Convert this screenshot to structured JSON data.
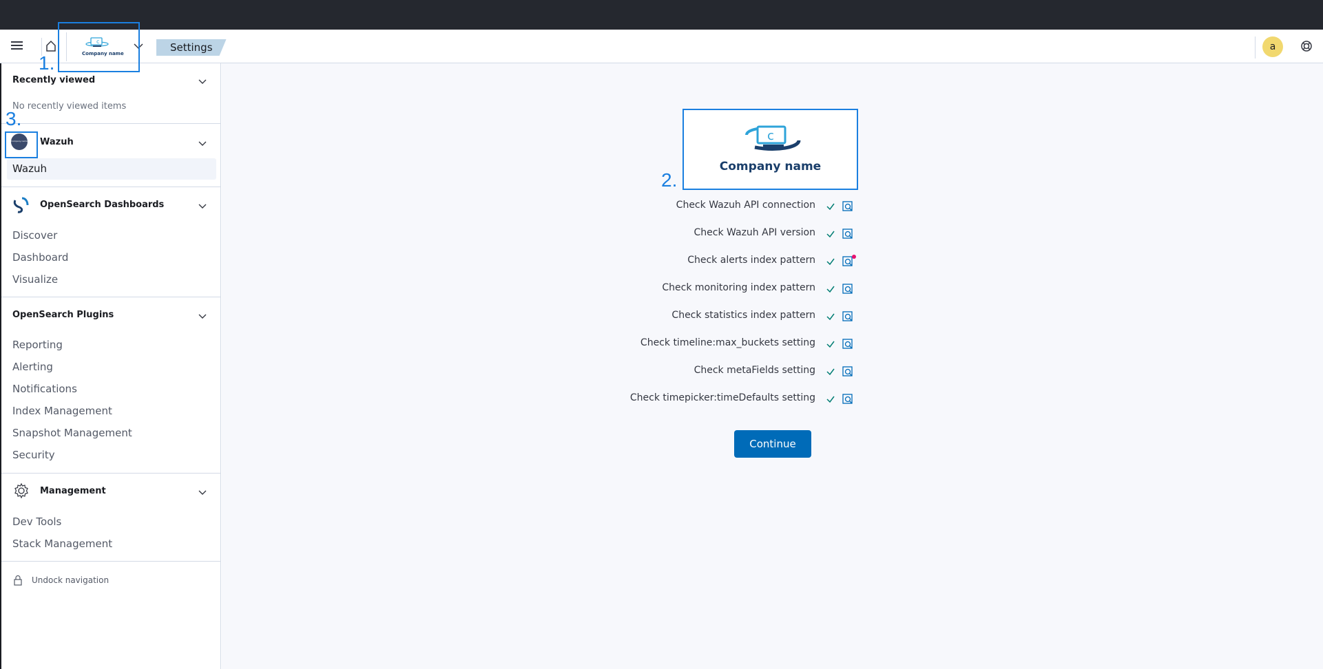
{
  "header": {
    "breadcrumb": "Settings",
    "avatar_initial": "a",
    "logo_text": "Company name"
  },
  "annotations": {
    "one": "1.",
    "two": "2.",
    "three": "3."
  },
  "sidebar": {
    "recently_viewed": {
      "title": "Recently viewed",
      "empty_text": "No recently viewed items"
    },
    "wazuh": {
      "title": "Wazuh",
      "item": "Wazuh",
      "icon_text": "Company name"
    },
    "opensearch_dashboards": {
      "title": "OpenSearch Dashboards",
      "items": [
        "Discover",
        "Dashboard",
        "Visualize"
      ]
    },
    "opensearch_plugins": {
      "title": "OpenSearch Plugins",
      "items": [
        "Reporting",
        "Alerting",
        "Notifications",
        "Index Management",
        "Snapshot Management",
        "Security"
      ]
    },
    "management": {
      "title": "Management",
      "items": [
        "Dev Tools",
        "Stack Management"
      ]
    },
    "undock_label": "Undock navigation"
  },
  "main": {
    "brand_name": "Company name",
    "checks": [
      {
        "label": "Check Wazuh API connection",
        "status": "ok"
      },
      {
        "label": "Check Wazuh API version",
        "status": "ok"
      },
      {
        "label": "Check alerts index pattern",
        "status": "ok"
      },
      {
        "label": "Check monitoring index pattern",
        "status": "ok"
      },
      {
        "label": "Check statistics index pattern",
        "status": "ok"
      },
      {
        "label": "Check timeline:max_buckets setting",
        "status": "ok"
      },
      {
        "label": "Check metaFields setting",
        "status": "ok"
      },
      {
        "label": "Check timepicker:timeDefaults setting",
        "status": "ok"
      }
    ],
    "continue_label": "Continue"
  },
  "colors": {
    "accent": "#006bb8",
    "annotation": "#1a7fe0",
    "success": "#017d73",
    "notification_dot": "#e7126f"
  }
}
